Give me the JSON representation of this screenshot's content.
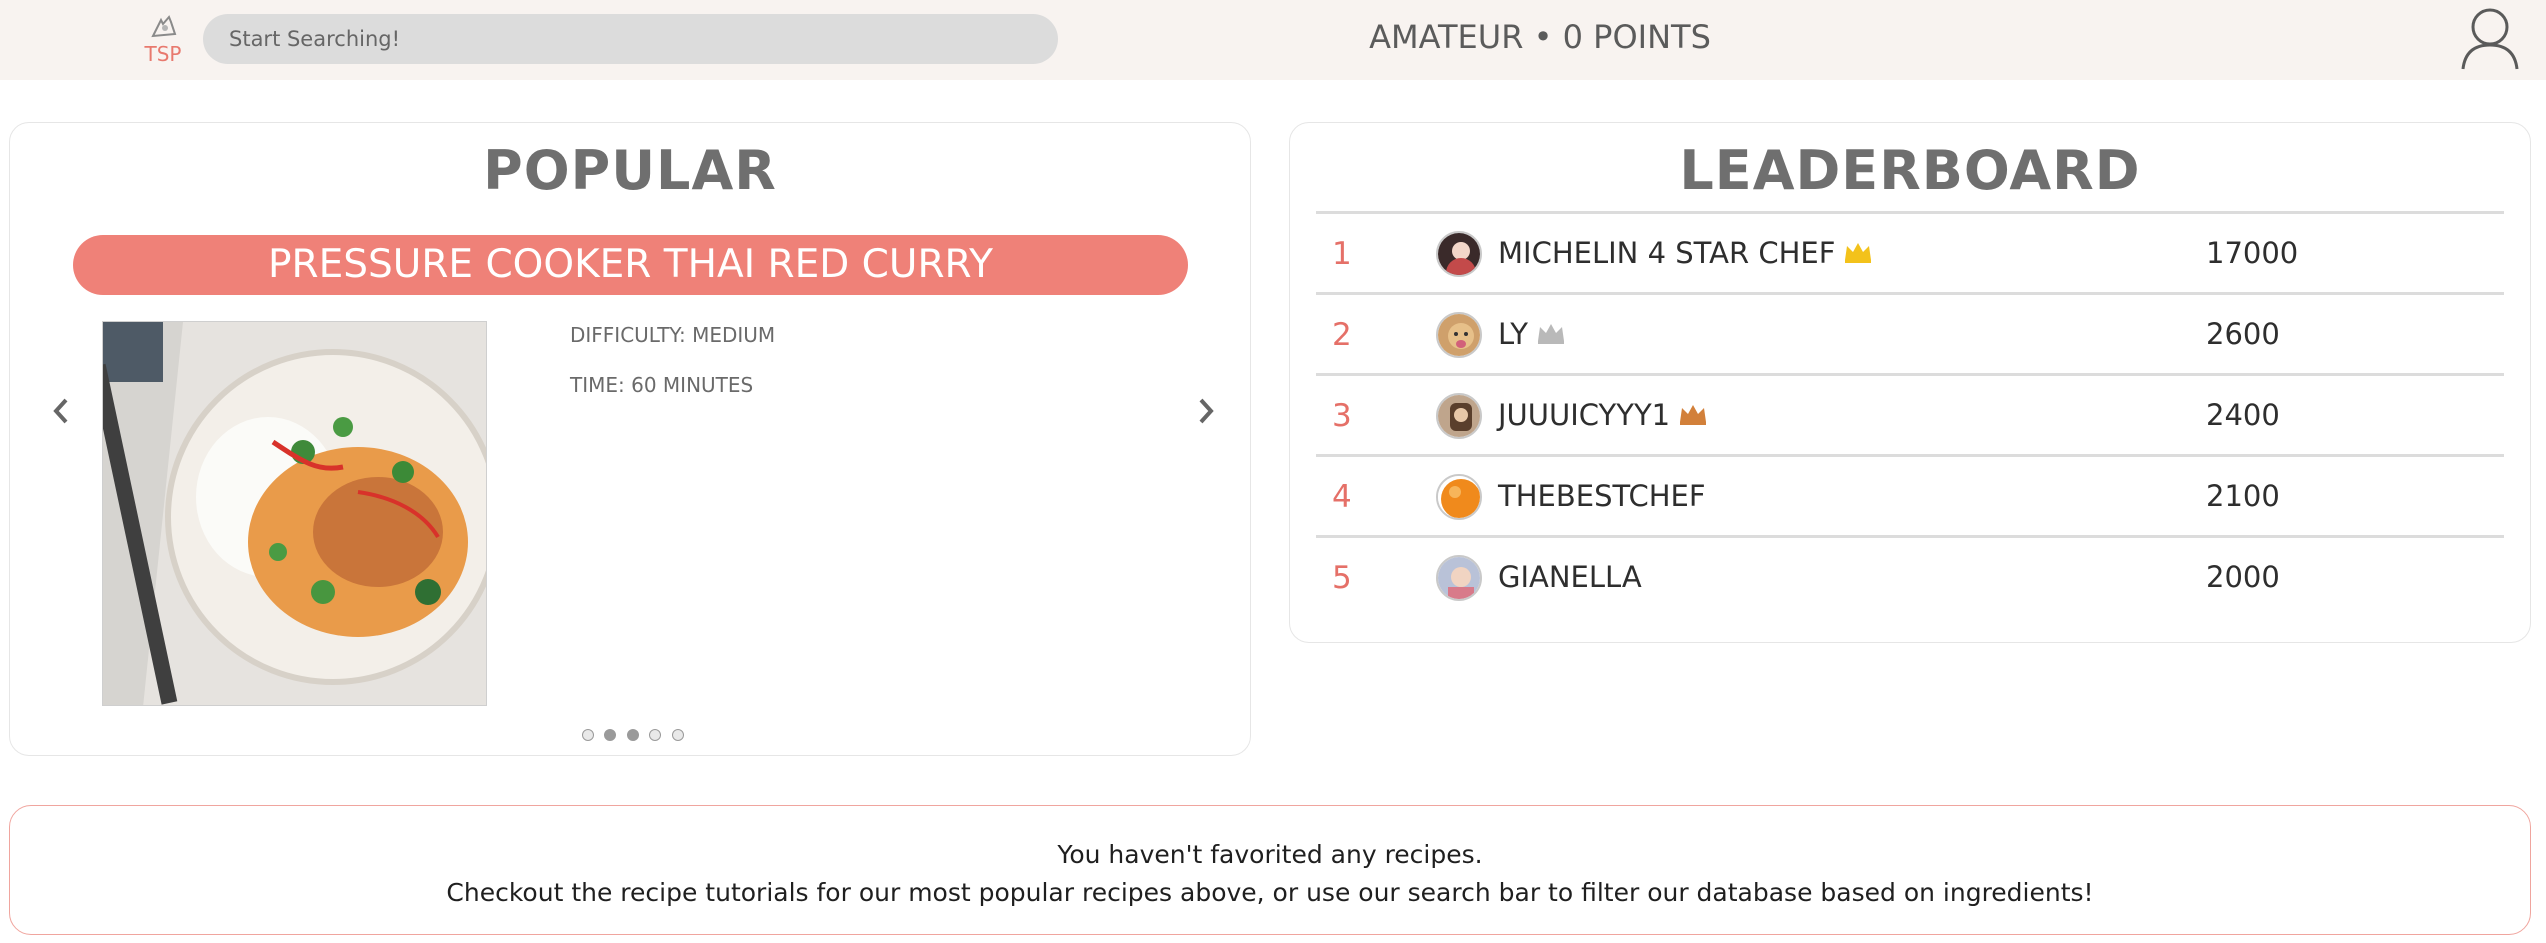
{
  "header": {
    "logo_text": "TSP",
    "search_placeholder": "Start Searching!",
    "status": "AMATEUR • 0 POINTS"
  },
  "popular": {
    "title": "POPULAR",
    "recipe_title": "PRESSURE COOKER THAI RED CURRY",
    "difficulty": "DIFFICULTY: MEDIUM",
    "time": "TIME: 60 MINUTES",
    "carousel_dots": 5,
    "active_dot": 2
  },
  "leaderboard": {
    "title": "LEADERBOARD",
    "rows": [
      {
        "rank": "1",
        "name": "MICHELIN 4 STAR CHEF",
        "points": "17000",
        "crown": "gold",
        "crown_color": "#f3c21b"
      },
      {
        "rank": "2",
        "name": "LY",
        "points": "2600",
        "crown": "silver",
        "crown_color": "#b9b9b9"
      },
      {
        "rank": "3",
        "name": "JUUUICYYY1",
        "points": "2400",
        "crown": "bronze",
        "crown_color": "#d2803a"
      },
      {
        "rank": "4",
        "name": "THEBESTCHEF",
        "points": "2100",
        "crown": "",
        "crown_color": ""
      },
      {
        "rank": "5",
        "name": "GIANELLA",
        "points": "2000",
        "crown": "",
        "crown_color": ""
      }
    ]
  },
  "favorites": {
    "line1": "You haven't favorited any recipes.",
    "line2": "Checkout the recipe tutorials for our most popular recipes above, or use our search bar to filter our database based on ingredients!"
  },
  "colors": {
    "accent": "#ef8178",
    "rank": "#e57068",
    "header_bg": "#f8f3f0"
  }
}
